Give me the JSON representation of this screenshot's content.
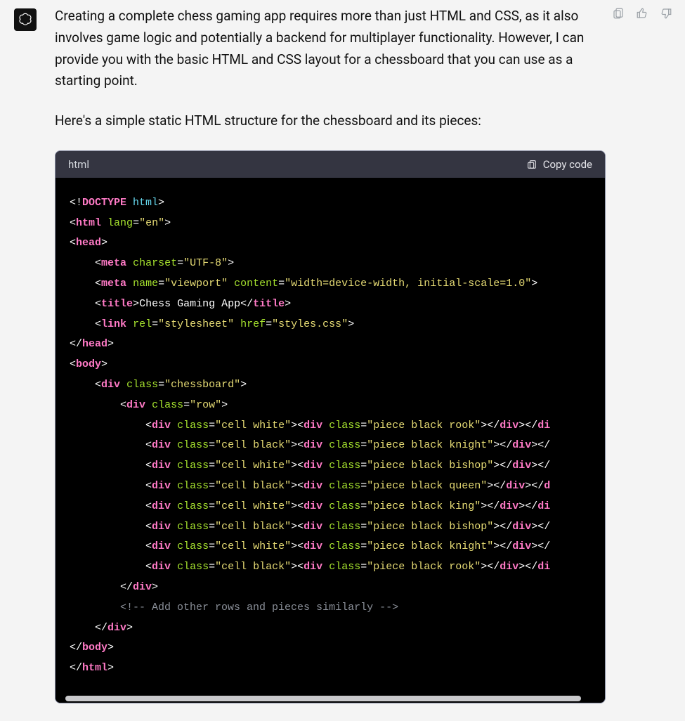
{
  "message": {
    "paragraph1": "Creating a complete chess gaming app requires more than just HTML and CSS, as it also involves game logic and potentially a backend for multiplayer functionality. However, I can provide you with the basic HTML and CSS layout for a chessboard that you can use as a starting point.",
    "paragraph2": "Here's a simple static HTML structure for the chessboard and its pieces:"
  },
  "codeblock": {
    "lang_label": "html",
    "copy_label": "Copy code",
    "tokens": [
      [
        [
          "punc",
          "<!"
        ],
        [
          "name",
          "DOCTYPE "
        ],
        [
          "doct",
          "html"
        ],
        [
          "punc",
          ">"
        ]
      ],
      [
        [
          "punc",
          "<"
        ],
        [
          "name",
          "html"
        ],
        [
          "punc",
          " "
        ],
        [
          "attr",
          "lang"
        ],
        [
          "punc",
          "="
        ],
        [
          "str",
          "\"en\""
        ],
        [
          "punc",
          ">"
        ]
      ],
      [
        [
          "punc",
          "<"
        ],
        [
          "name",
          "head"
        ],
        [
          "punc",
          ">"
        ]
      ],
      [
        [
          "text",
          "    "
        ],
        [
          "punc",
          "<"
        ],
        [
          "name",
          "meta"
        ],
        [
          "punc",
          " "
        ],
        [
          "attr",
          "charset"
        ],
        [
          "punc",
          "="
        ],
        [
          "str",
          "\"UTF-8\""
        ],
        [
          "punc",
          ">"
        ]
      ],
      [
        [
          "text",
          "    "
        ],
        [
          "punc",
          "<"
        ],
        [
          "name",
          "meta"
        ],
        [
          "punc",
          " "
        ],
        [
          "attr",
          "name"
        ],
        [
          "punc",
          "="
        ],
        [
          "str",
          "\"viewport\""
        ],
        [
          "punc",
          " "
        ],
        [
          "attr",
          "content"
        ],
        [
          "punc",
          "="
        ],
        [
          "str",
          "\"width=device-width, initial-scale=1.0\""
        ],
        [
          "punc",
          ">"
        ]
      ],
      [
        [
          "text",
          "    "
        ],
        [
          "punc",
          "<"
        ],
        [
          "name",
          "title"
        ],
        [
          "punc",
          ">"
        ],
        [
          "text",
          "Chess Gaming App"
        ],
        [
          "punc",
          "</"
        ],
        [
          "name",
          "title"
        ],
        [
          "punc",
          ">"
        ]
      ],
      [
        [
          "text",
          "    "
        ],
        [
          "punc",
          "<"
        ],
        [
          "name",
          "link"
        ],
        [
          "punc",
          " "
        ],
        [
          "attr",
          "rel"
        ],
        [
          "punc",
          "="
        ],
        [
          "str",
          "\"stylesheet\""
        ],
        [
          "punc",
          " "
        ],
        [
          "attr",
          "href"
        ],
        [
          "punc",
          "="
        ],
        [
          "str",
          "\"styles.css\""
        ],
        [
          "punc",
          ">"
        ]
      ],
      [
        [
          "punc",
          "</"
        ],
        [
          "name",
          "head"
        ],
        [
          "punc",
          ">"
        ]
      ],
      [
        [
          "punc",
          "<"
        ],
        [
          "name",
          "body"
        ],
        [
          "punc",
          ">"
        ]
      ],
      [
        [
          "text",
          "    "
        ],
        [
          "punc",
          "<"
        ],
        [
          "name",
          "div"
        ],
        [
          "punc",
          " "
        ],
        [
          "attr",
          "class"
        ],
        [
          "punc",
          "="
        ],
        [
          "str",
          "\"chessboard\""
        ],
        [
          "punc",
          ">"
        ]
      ],
      [
        [
          "text",
          "        "
        ],
        [
          "punc",
          "<"
        ],
        [
          "name",
          "div"
        ],
        [
          "punc",
          " "
        ],
        [
          "attr",
          "class"
        ],
        [
          "punc",
          "="
        ],
        [
          "str",
          "\"row\""
        ],
        [
          "punc",
          ">"
        ]
      ],
      [
        [
          "text",
          "            "
        ],
        [
          "punc",
          "<"
        ],
        [
          "name",
          "div"
        ],
        [
          "punc",
          " "
        ],
        [
          "attr",
          "class"
        ],
        [
          "punc",
          "="
        ],
        [
          "str",
          "\"cell white\""
        ],
        [
          "punc",
          "><"
        ],
        [
          "name",
          "div"
        ],
        [
          "punc",
          " "
        ],
        [
          "attr",
          "class"
        ],
        [
          "punc",
          "="
        ],
        [
          "str",
          "\"piece black rook\""
        ],
        [
          "punc",
          "></"
        ],
        [
          "name",
          "div"
        ],
        [
          "punc",
          "></"
        ],
        [
          "name",
          "di"
        ]
      ],
      [
        [
          "text",
          "            "
        ],
        [
          "punc",
          "<"
        ],
        [
          "name",
          "div"
        ],
        [
          "punc",
          " "
        ],
        [
          "attr",
          "class"
        ],
        [
          "punc",
          "="
        ],
        [
          "str",
          "\"cell black\""
        ],
        [
          "punc",
          "><"
        ],
        [
          "name",
          "div"
        ],
        [
          "punc",
          " "
        ],
        [
          "attr",
          "class"
        ],
        [
          "punc",
          "="
        ],
        [
          "str",
          "\"piece black knight\""
        ],
        [
          "punc",
          "></"
        ],
        [
          "name",
          "div"
        ],
        [
          "punc",
          "></"
        ]
      ],
      [
        [
          "text",
          "            "
        ],
        [
          "punc",
          "<"
        ],
        [
          "name",
          "div"
        ],
        [
          "punc",
          " "
        ],
        [
          "attr",
          "class"
        ],
        [
          "punc",
          "="
        ],
        [
          "str",
          "\"cell white\""
        ],
        [
          "punc",
          "><"
        ],
        [
          "name",
          "div"
        ],
        [
          "punc",
          " "
        ],
        [
          "attr",
          "class"
        ],
        [
          "punc",
          "="
        ],
        [
          "str",
          "\"piece black bishop\""
        ],
        [
          "punc",
          "></"
        ],
        [
          "name",
          "div"
        ],
        [
          "punc",
          "></"
        ]
      ],
      [
        [
          "text",
          "            "
        ],
        [
          "punc",
          "<"
        ],
        [
          "name",
          "div"
        ],
        [
          "punc",
          " "
        ],
        [
          "attr",
          "class"
        ],
        [
          "punc",
          "="
        ],
        [
          "str",
          "\"cell black\""
        ],
        [
          "punc",
          "><"
        ],
        [
          "name",
          "div"
        ],
        [
          "punc",
          " "
        ],
        [
          "attr",
          "class"
        ],
        [
          "punc",
          "="
        ],
        [
          "str",
          "\"piece black queen\""
        ],
        [
          "punc",
          "></"
        ],
        [
          "name",
          "div"
        ],
        [
          "punc",
          "></"
        ],
        [
          "name",
          "d"
        ]
      ],
      [
        [
          "text",
          "            "
        ],
        [
          "punc",
          "<"
        ],
        [
          "name",
          "div"
        ],
        [
          "punc",
          " "
        ],
        [
          "attr",
          "class"
        ],
        [
          "punc",
          "="
        ],
        [
          "str",
          "\"cell white\""
        ],
        [
          "punc",
          "><"
        ],
        [
          "name",
          "div"
        ],
        [
          "punc",
          " "
        ],
        [
          "attr",
          "class"
        ],
        [
          "punc",
          "="
        ],
        [
          "str",
          "\"piece black king\""
        ],
        [
          "punc",
          "></"
        ],
        [
          "name",
          "div"
        ],
        [
          "punc",
          "></"
        ],
        [
          "name",
          "di"
        ]
      ],
      [
        [
          "text",
          "            "
        ],
        [
          "punc",
          "<"
        ],
        [
          "name",
          "div"
        ],
        [
          "punc",
          " "
        ],
        [
          "attr",
          "class"
        ],
        [
          "punc",
          "="
        ],
        [
          "str",
          "\"cell black\""
        ],
        [
          "punc",
          "><"
        ],
        [
          "name",
          "div"
        ],
        [
          "punc",
          " "
        ],
        [
          "attr",
          "class"
        ],
        [
          "punc",
          "="
        ],
        [
          "str",
          "\"piece black bishop\""
        ],
        [
          "punc",
          "></"
        ],
        [
          "name",
          "div"
        ],
        [
          "punc",
          "></"
        ]
      ],
      [
        [
          "text",
          "            "
        ],
        [
          "punc",
          "<"
        ],
        [
          "name",
          "div"
        ],
        [
          "punc",
          " "
        ],
        [
          "attr",
          "class"
        ],
        [
          "punc",
          "="
        ],
        [
          "str",
          "\"cell white\""
        ],
        [
          "punc",
          "><"
        ],
        [
          "name",
          "div"
        ],
        [
          "punc",
          " "
        ],
        [
          "attr",
          "class"
        ],
        [
          "punc",
          "="
        ],
        [
          "str",
          "\"piece black knight\""
        ],
        [
          "punc",
          "></"
        ],
        [
          "name",
          "div"
        ],
        [
          "punc",
          "></"
        ]
      ],
      [
        [
          "text",
          "            "
        ],
        [
          "punc",
          "<"
        ],
        [
          "name",
          "div"
        ],
        [
          "punc",
          " "
        ],
        [
          "attr",
          "class"
        ],
        [
          "punc",
          "="
        ],
        [
          "str",
          "\"cell black\""
        ],
        [
          "punc",
          "><"
        ],
        [
          "name",
          "div"
        ],
        [
          "punc",
          " "
        ],
        [
          "attr",
          "class"
        ],
        [
          "punc",
          "="
        ],
        [
          "str",
          "\"piece black rook\""
        ],
        [
          "punc",
          "></"
        ],
        [
          "name",
          "div"
        ],
        [
          "punc",
          "></"
        ],
        [
          "name",
          "di"
        ]
      ],
      [
        [
          "text",
          "        "
        ],
        [
          "punc",
          "</"
        ],
        [
          "name",
          "div"
        ],
        [
          "punc",
          ">"
        ]
      ],
      [
        [
          "text",
          "        "
        ],
        [
          "comm",
          "<!-- Add other rows and pieces similarly -->"
        ]
      ],
      [
        [
          "text",
          "    "
        ],
        [
          "punc",
          "</"
        ],
        [
          "name",
          "div"
        ],
        [
          "punc",
          ">"
        ]
      ],
      [
        [
          "punc",
          "</"
        ],
        [
          "name",
          "body"
        ],
        [
          "punc",
          ">"
        ]
      ],
      [
        [
          "punc",
          "</"
        ],
        [
          "name",
          "html"
        ],
        [
          "punc",
          ">"
        ]
      ]
    ]
  }
}
